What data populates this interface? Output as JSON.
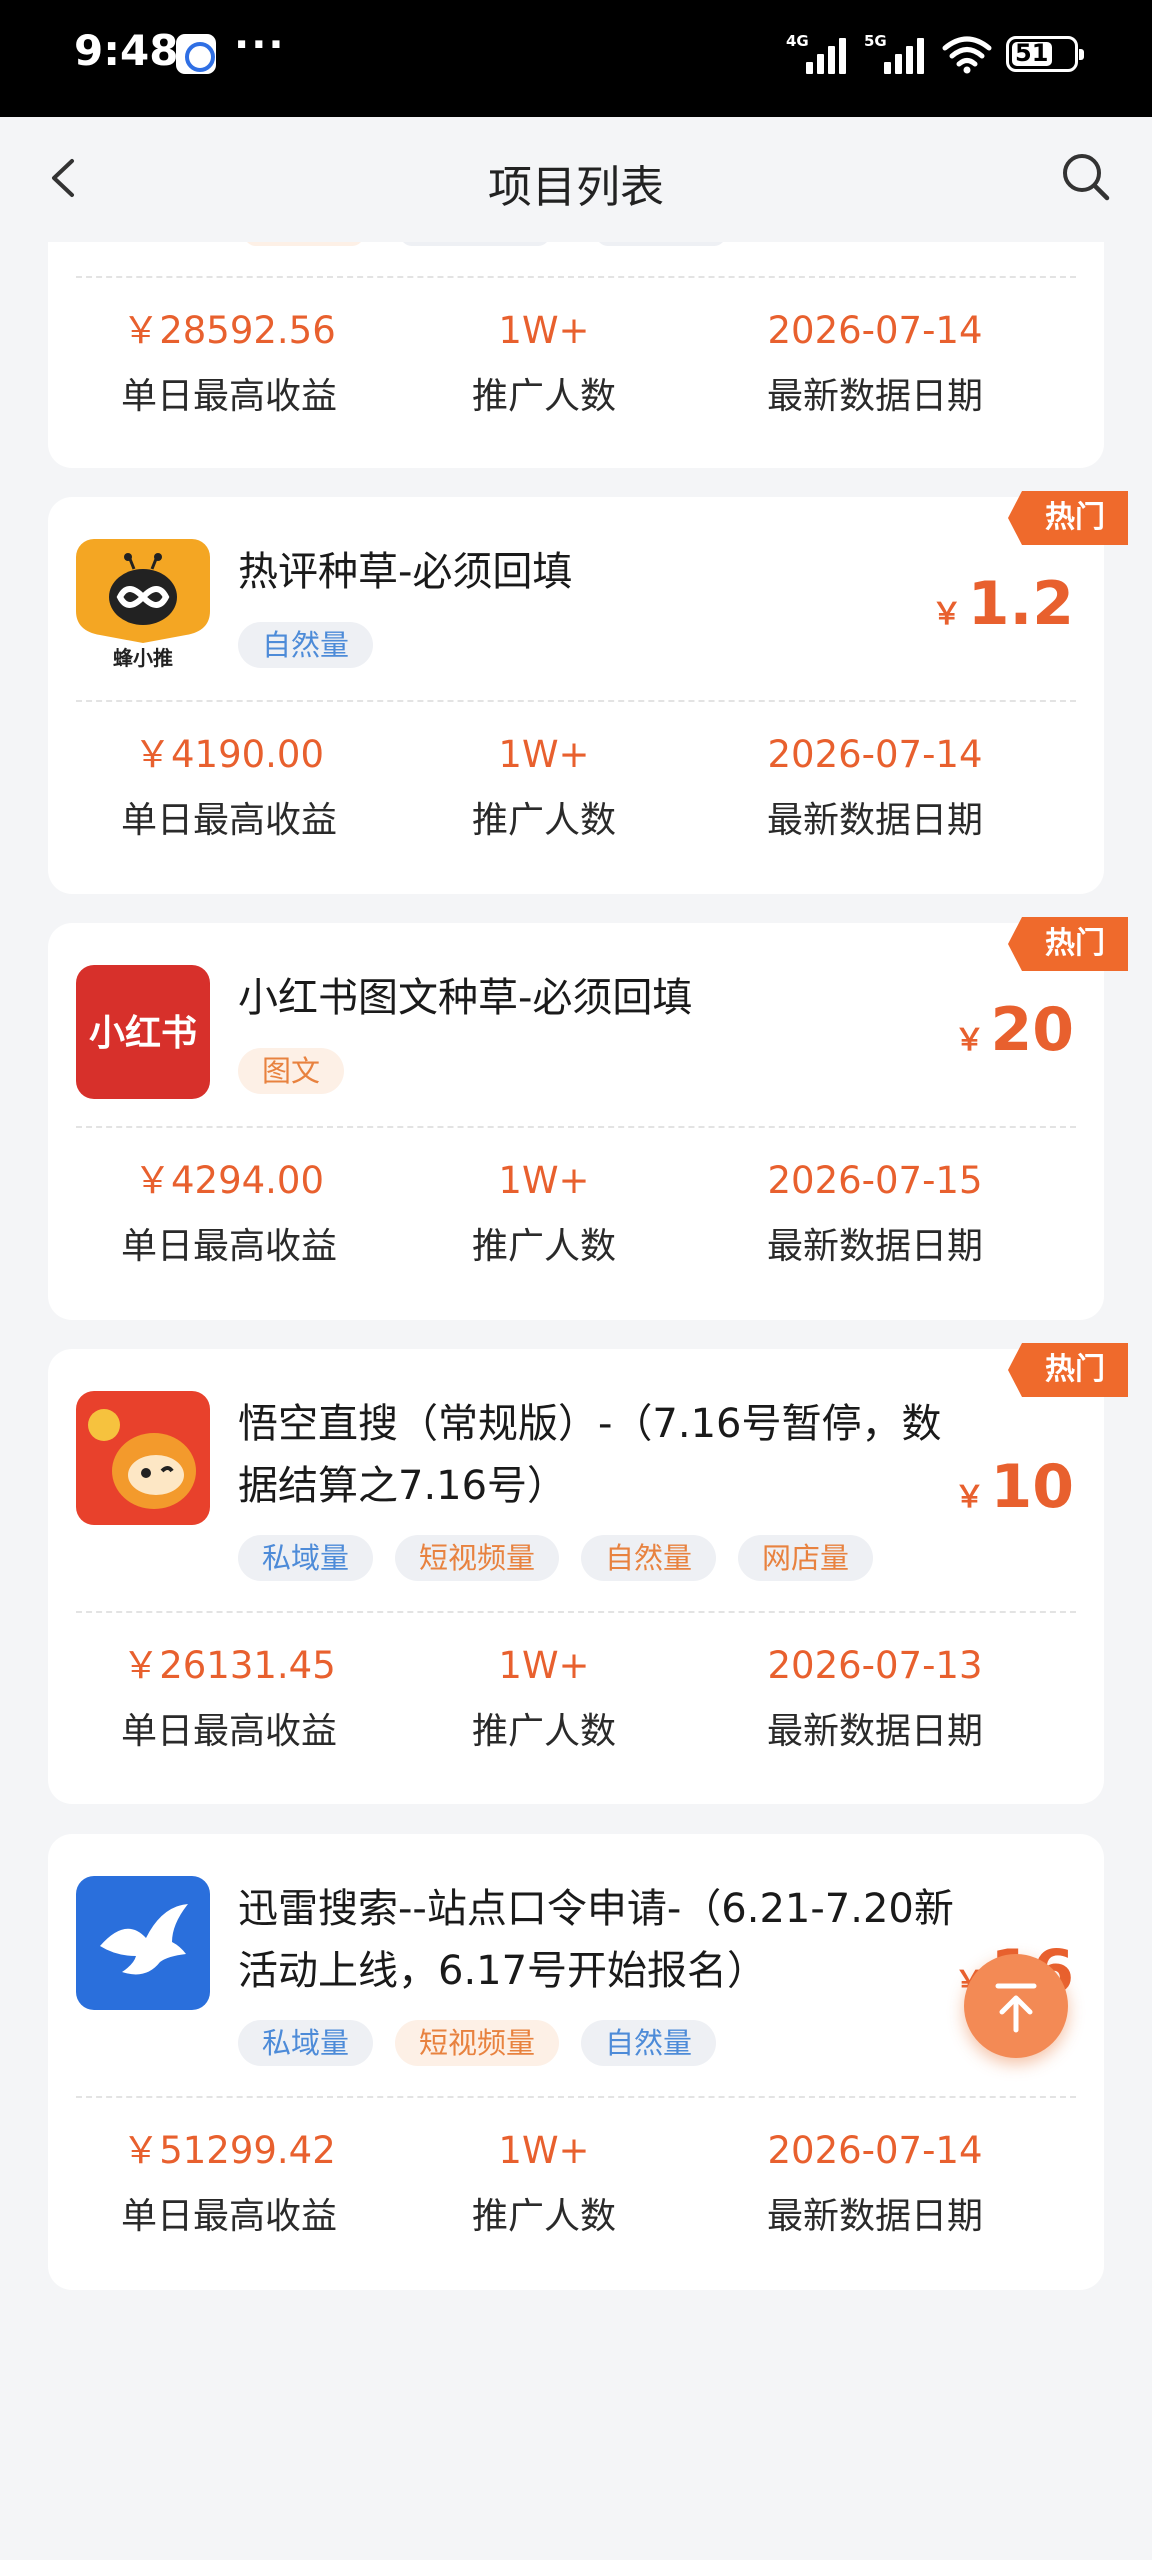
{
  "status_bar": {
    "time": "9:48",
    "dots": "···",
    "signal1": "4G",
    "signal2": "5G",
    "battery": "51"
  },
  "nav": {
    "title": "项目列表"
  },
  "stat_labels": {
    "max_income": "单日最高收益",
    "promoters": "推广人数",
    "date": "最新数据日期"
  },
  "colors": {
    "accent": "#e8602e",
    "hot_badge": "#ef6a2c",
    "tag_blue_text": "#4d8bd8",
    "tag_orange_text": "#e8823f",
    "fab": "#f38a55"
  },
  "cards": [
    {
      "stats": {
        "max_income": "￥28592.56",
        "promoters": "1W+",
        "date": "2026-07-14"
      }
    },
    {
      "logo": "bee-logo-icon",
      "logo_text": "蜂小推",
      "title": "热评种草-必须回填",
      "hot": "热门",
      "tags": [
        {
          "label": "自然量",
          "color": "blue"
        }
      ],
      "price_currency": "￥",
      "price": "1.2",
      "stats": {
        "max_income": "￥4190.00",
        "promoters": "1W+",
        "date": "2026-07-14"
      }
    },
    {
      "logo": "xiaohongshu-logo-icon",
      "logo_text": "小红书",
      "title": "小红书图文种草-必须回填",
      "hot": "热门",
      "tags": [
        {
          "label": "图文",
          "color": "orange"
        }
      ],
      "price_currency": "￥",
      "price": "20",
      "stats": {
        "max_income": "￥4294.00",
        "promoters": "1W+",
        "date": "2026-07-15"
      }
    },
    {
      "logo": "wukong-logo-icon",
      "title": "悟空直搜（常规版）-（7.16号暂停，数据结算之7.16号）",
      "hot": "热门",
      "tags": [
        {
          "label": "私域量",
          "color": "blue"
        },
        {
          "label": "短视频量",
          "color": "orange"
        },
        {
          "label": "自然量",
          "color": "orange"
        },
        {
          "label": "网店量",
          "color": "orange"
        }
      ],
      "price_currency": "￥",
      "price": "10",
      "stats": {
        "max_income": "￥26131.45",
        "promoters": "1W+",
        "date": "2026-07-13"
      }
    },
    {
      "logo": "xunlei-bird-logo-icon",
      "title": "迅雷搜索--站点口令申请-（6.21-7.20新活动上线，6.17号开始报名）",
      "tags": [
        {
          "label": "私域量",
          "color": "blue"
        },
        {
          "label": "短视频量",
          "color": "orange"
        },
        {
          "label": "自然量",
          "color": "blue"
        }
      ],
      "price_currency": "￥",
      "price": "16",
      "stats": {
        "max_income": "￥51299.42",
        "promoters": "1W+",
        "date": "2026-07-14"
      }
    }
  ]
}
